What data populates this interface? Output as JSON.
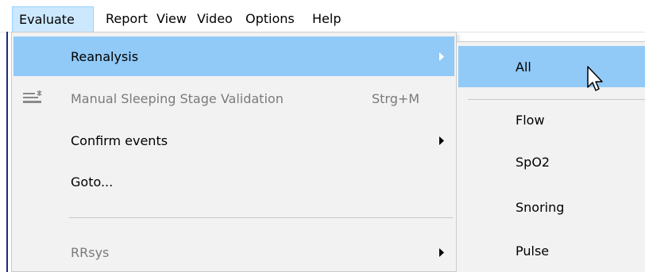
{
  "menubar": {
    "items": [
      {
        "label": "Evaluate"
      },
      {
        "label": "Report"
      },
      {
        "label": "View"
      },
      {
        "label": "Video"
      },
      {
        "label": "Options"
      },
      {
        "label": "Help"
      }
    ]
  },
  "evaluate_menu": {
    "items": [
      {
        "label": "Reanalysis",
        "has_submenu": true,
        "highlighted": true
      },
      {
        "label": "Manual Sleeping Stage Validation",
        "shortcut": "Strg+M",
        "disabled": true,
        "icon": "stage-validation-icon"
      },
      {
        "label": "Confirm events",
        "has_submenu": true
      },
      {
        "label": "Goto..."
      },
      {
        "label": "RRsys",
        "has_submenu": true,
        "disabled": true
      }
    ]
  },
  "reanalysis_submenu": {
    "items": [
      {
        "label": "All",
        "highlighted": true
      },
      {
        "label": "Flow"
      },
      {
        "label": "SpO2"
      },
      {
        "label": "Snoring"
      },
      {
        "label": "Pulse"
      }
    ]
  },
  "colors": {
    "highlight": "#91c9f7",
    "menubar_open": "#cce8ff",
    "menu_bg": "#f2f2f2",
    "disabled_text": "#7a7a7a"
  }
}
